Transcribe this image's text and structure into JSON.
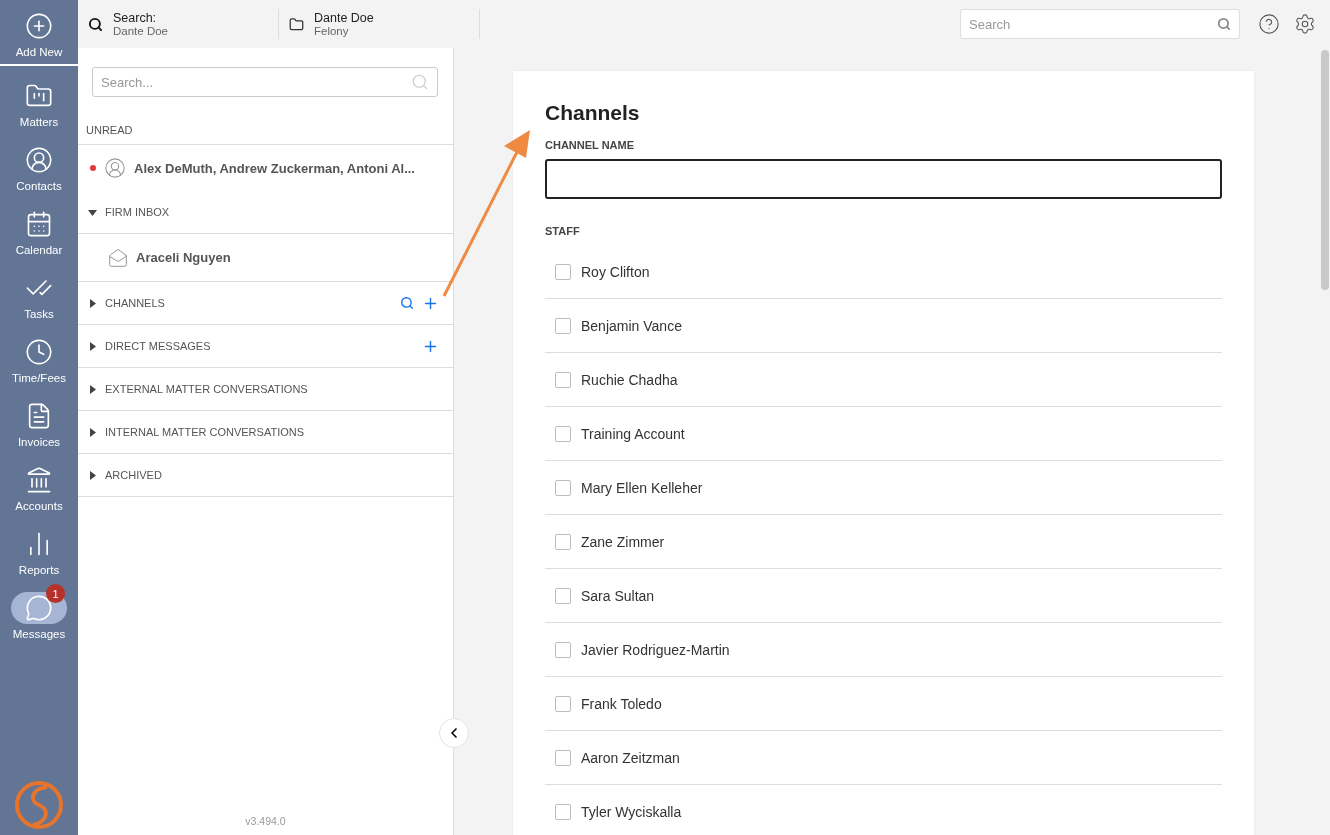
{
  "nav": {
    "items": [
      {
        "label": "Add New",
        "selected": false
      },
      {
        "label": "Matters",
        "selected": false
      },
      {
        "label": "Contacts",
        "selected": false
      },
      {
        "label": "Calendar",
        "selected": false
      },
      {
        "label": "Tasks",
        "selected": false
      },
      {
        "label": "Time/Fees",
        "selected": false
      },
      {
        "label": "Invoices",
        "selected": false
      },
      {
        "label": "Accounts",
        "selected": false
      },
      {
        "label": "Reports",
        "selected": false
      },
      {
        "label": "Messages",
        "selected": true,
        "badge": "1"
      }
    ]
  },
  "topbar": {
    "crumbs": [
      {
        "title": "Search:",
        "subtitle": "Dante Doe"
      },
      {
        "title": "Dante Doe",
        "subtitle": "Felony"
      }
    ],
    "search": {
      "placeholder": "Search"
    }
  },
  "conversations": {
    "search": {
      "placeholder": "Search..."
    },
    "unread": {
      "label": "UNREAD",
      "items": [
        {
          "name": "Alex DeMuth, Andrew Zuckerman, Antoni Al...",
          "unread": true
        }
      ]
    },
    "sections": [
      {
        "label": "FIRM INBOX",
        "expanded": true,
        "searchable": false,
        "addable": false,
        "items": [
          {
            "name": "Araceli Nguyen"
          }
        ]
      },
      {
        "label": "CHANNELS",
        "expanded": false,
        "searchable": true,
        "addable": true
      },
      {
        "label": "DIRECT MESSAGES",
        "expanded": false,
        "searchable": false,
        "addable": true
      },
      {
        "label": "EXTERNAL MATTER CONVERSATIONS",
        "expanded": false,
        "searchable": false,
        "addable": false
      },
      {
        "label": "INTERNAL MATTER CONVERSATIONS",
        "expanded": false,
        "searchable": false,
        "addable": false
      },
      {
        "label": "ARCHIVED",
        "expanded": false,
        "searchable": false,
        "addable": false
      }
    ],
    "version": "v3.494.0"
  },
  "form": {
    "title": "Channels",
    "channel_name_label": "CHANNEL NAME",
    "staff_label": "STAFF",
    "staff": [
      {
        "name": "Roy Clifton",
        "checked": false
      },
      {
        "name": "Benjamin Vance",
        "checked": false
      },
      {
        "name": "Ruchie Chadha",
        "checked": false
      },
      {
        "name": "Training Account",
        "checked": false
      },
      {
        "name": "Mary Ellen Kelleher",
        "checked": false
      },
      {
        "name": "Zane Zimmer",
        "checked": false
      },
      {
        "name": "Sara Sultan",
        "checked": false
      },
      {
        "name": "Javier Rodriguez-Martin",
        "checked": false
      },
      {
        "name": "Frank Toledo",
        "checked": false
      },
      {
        "name": "Aaron Zeitzman",
        "checked": false
      },
      {
        "name": "Tyler Wyciskalla",
        "checked": false
      }
    ]
  }
}
